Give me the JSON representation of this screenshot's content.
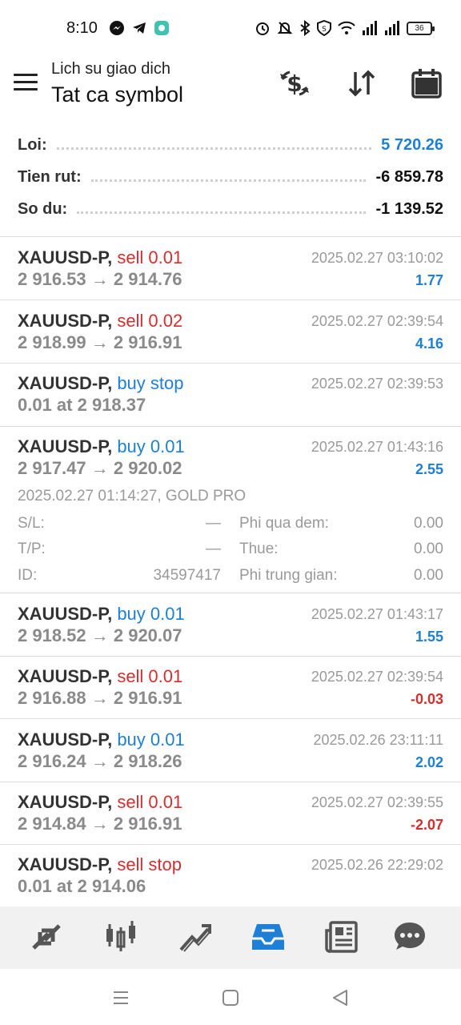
{
  "status_bar": {
    "time": "8:10",
    "battery": "36",
    "left_icons": [
      "messenger-icon",
      "telegram-icon",
      "app-icon"
    ],
    "right_icons": [
      "alarm-icon",
      "mute-icon",
      "bluetooth-icon",
      "vpn-shield-icon",
      "wifi-icon",
      "signal-icon",
      "signal-icon",
      "battery-icon"
    ]
  },
  "header": {
    "subtitle": "Lich su giao dich",
    "title": "Tat ca symbol",
    "actions": [
      "dollar-sync-icon",
      "sort-icon",
      "calendar-icon"
    ]
  },
  "summary": [
    {
      "label": "Loi:",
      "value": "5 720.26",
      "color": "#1e7fd6"
    },
    {
      "label": "Tien rut:",
      "value": "-6 859.78",
      "color": "#111111"
    },
    {
      "label": "So du:",
      "value": "-1 139.52",
      "color": "#111111"
    }
  ],
  "deals": [
    {
      "symbol": "XAUUSD-P,",
      "type": "sell 0.01",
      "side": "sell",
      "time": "2025.02.27 03:10:02",
      "prices": "2 916.53 → 2 914.76",
      "profit": "1.77",
      "sign": "pos"
    },
    {
      "symbol": "XAUUSD-P,",
      "type": "sell 0.02",
      "side": "sell",
      "time": "2025.02.27 02:39:54",
      "prices": "2 918.99 → 2 916.91",
      "profit": "4.16",
      "sign": "pos"
    },
    {
      "symbol": "XAUUSD-P,",
      "type": "buy stop",
      "side": "buy",
      "time": "2025.02.27 02:39:53",
      "prices": "0.01 at 2 918.37",
      "profit": "",
      "sign": "pos"
    },
    {
      "symbol": "XAUUSD-P,",
      "type": "buy 0.01",
      "side": "buy",
      "time": "2025.02.27 01:43:16",
      "prices": "2 917.47 → 2 920.02",
      "profit": "2.55",
      "sign": "pos"
    },
    {
      "symbol": "XAUUSD-P,",
      "type": "buy 0.01",
      "side": "buy",
      "time": "2025.02.27 01:43:17",
      "prices": "2 918.52 → 2 920.07",
      "profit": "1.55",
      "sign": "pos"
    },
    {
      "symbol": "XAUUSD-P,",
      "type": "sell 0.01",
      "side": "sell",
      "time": "2025.02.27 02:39:54",
      "prices": "2 916.88 → 2 916.91",
      "profit": "-0.03",
      "sign": "neg"
    },
    {
      "symbol": "XAUUSD-P,",
      "type": "buy 0.01",
      "side": "buy",
      "time": "2025.02.26 23:11:11",
      "prices": "2 916.24 → 2 918.26",
      "profit": "2.02",
      "sign": "pos"
    },
    {
      "symbol": "XAUUSD-P,",
      "type": "sell 0.01",
      "side": "sell",
      "time": "2025.02.27 02:39:55",
      "prices": "2 914.84 → 2 916.91",
      "profit": "-2.07",
      "sign": "neg"
    },
    {
      "symbol": "XAUUSD-P,",
      "type": "sell stop",
      "side": "sell",
      "time": "2025.02.26 22:29:02",
      "prices": "0.01 at 2 914.06",
      "profit": "",
      "sign": "pos"
    }
  ],
  "details": {
    "header": "2025.02.27 01:14:27, GOLD PRO",
    "rows": [
      {
        "label": "S/L:",
        "value": "—",
        "label2": "Phi qua dem:",
        "value2": "0.00"
      },
      {
        "label": "T/P:",
        "value": "—",
        "label2": "Thue:",
        "value2": "0.00"
      },
      {
        "label": "ID:",
        "value": "34597417",
        "label2": "Phi trung gian:",
        "value2": "0.00"
      }
    ]
  },
  "bottom_nav": {
    "items": [
      "quotes-icon",
      "chart-icon",
      "trade-icon",
      "history-icon",
      "news-icon",
      "chat-icon"
    ],
    "active": "history-icon",
    "active_color": "#1e7fd6"
  },
  "system_nav": [
    "recents-icon",
    "home-icon",
    "back-icon"
  ]
}
